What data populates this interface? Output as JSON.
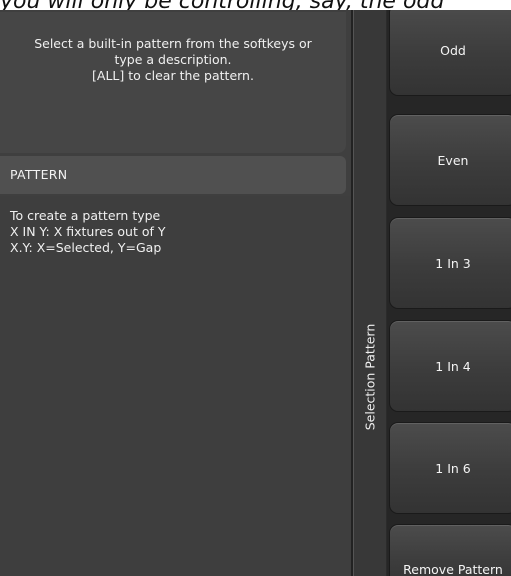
{
  "caption": "you will only be controlling, say, the odd",
  "prompt": {
    "line1": "Select a built-in pattern from the softkeys or",
    "line2": "type a description.",
    "line3": "[ALL] to clear the pattern."
  },
  "pattern_header": "PATTERN",
  "help": {
    "line1": "To create a pattern type",
    "line2": "X IN Y: X fixtures out of Y",
    "line3": "X.Y: X=Selected, Y=Gap"
  },
  "side_label": "Selection Pattern",
  "softkeys": {
    "odd": "Odd",
    "even": "Even",
    "one_in_3": "1 In 3",
    "one_in_4": "1 In 4",
    "one_in_6": "1 In 6",
    "remove_pattern": "Remove Pattern"
  }
}
